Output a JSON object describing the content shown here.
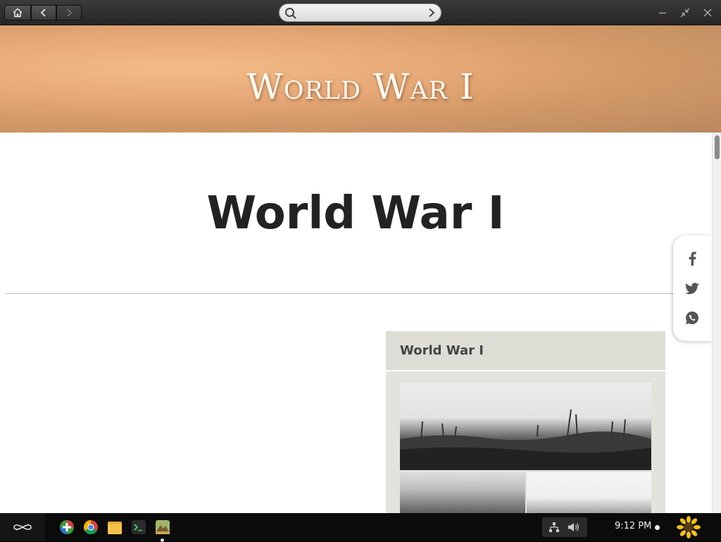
{
  "browser": {
    "search_placeholder": "",
    "home_icon": "home-icon",
    "back_icon": "back-arrow-icon",
    "forward_icon": "forward-arrow-icon"
  },
  "page": {
    "banner_title": "World War I",
    "article_title": "World War I",
    "infobox": {
      "title": "World War I"
    },
    "share": [
      "facebook-icon",
      "twitter-icon",
      "whatsapp-icon"
    ]
  },
  "taskbar": {
    "apps": [
      "app-center-icon",
      "chrome-icon",
      "files-icon",
      "terminal-icon",
      "encyclopedia-icon"
    ],
    "clock": "9:12 PM"
  },
  "colors": {
    "banner": "#e0a674",
    "infobox": "#e3e3dd",
    "title": "#222222"
  }
}
